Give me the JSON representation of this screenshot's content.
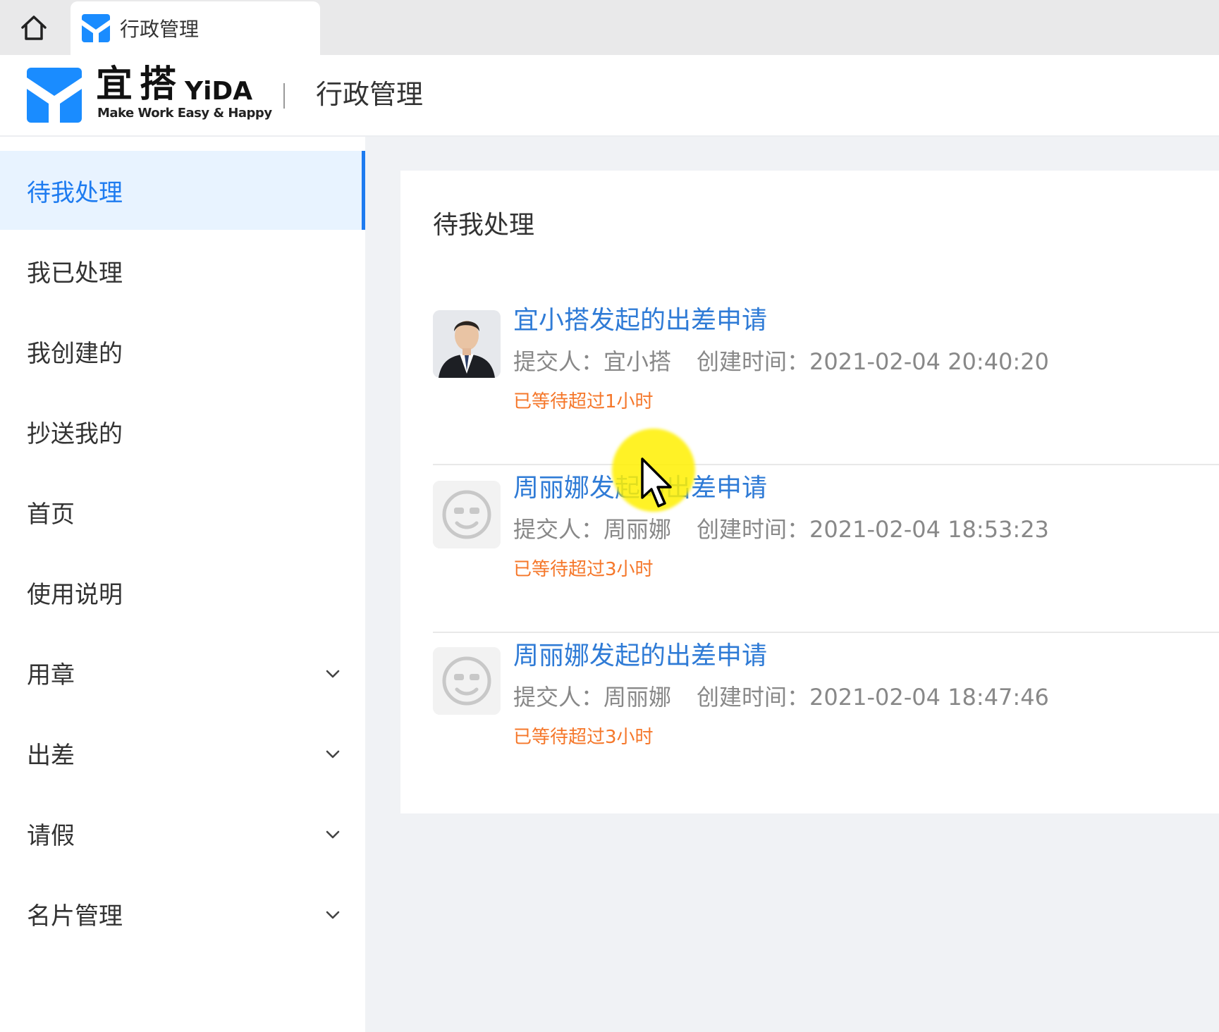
{
  "browser": {
    "tab_title": "行政管理"
  },
  "header": {
    "brand_cn": "宜搭",
    "brand_en": "YiDA",
    "tagline": "Make Work Easy & Happy",
    "app_title": "行政管理"
  },
  "sidebar": {
    "items": [
      {
        "label": "待我处理",
        "active": true,
        "expandable": false
      },
      {
        "label": "我已处理",
        "active": false,
        "expandable": false
      },
      {
        "label": "我创建的",
        "active": false,
        "expandable": false
      },
      {
        "label": "抄送我的",
        "active": false,
        "expandable": false
      },
      {
        "label": "首页",
        "active": false,
        "expandable": false
      },
      {
        "label": "使用说明",
        "active": false,
        "expandable": false
      },
      {
        "label": "用章",
        "active": false,
        "expandable": true
      },
      {
        "label": "出差",
        "active": false,
        "expandable": true
      },
      {
        "label": "请假",
        "active": false,
        "expandable": true
      },
      {
        "label": "名片管理",
        "active": false,
        "expandable": true
      }
    ]
  },
  "main": {
    "title": "待我处理",
    "tasks": [
      {
        "title": "宜小搭发起的出差申请",
        "submitter_label": "提交人：",
        "submitter": "宜小搭",
        "created_label": "创建时间：",
        "created": "2021-02-04 20:40:20",
        "wait": "已等待超过1小时",
        "avatar": "photo-avatar"
      },
      {
        "title": "周丽娜发起的出差申请",
        "submitter_label": "提交人：",
        "submitter": "周丽娜",
        "created_label": "创建时间：",
        "created": "2021-02-04 18:53:23",
        "wait": "已等待超过3小时",
        "avatar": "default-face-avatar"
      },
      {
        "title": "周丽娜发起的出差申请",
        "submitter_label": "提交人：",
        "submitter": "周丽娜",
        "created_label": "创建时间：",
        "created": "2021-02-04 18:47:46",
        "wait": "已等待超过3小时",
        "avatar": "default-face-avatar"
      }
    ]
  },
  "colors": {
    "accent": "#1d7bf0",
    "link": "#2f7bd6",
    "warning": "#f5772a",
    "logo_blue": "#1a8cff"
  }
}
